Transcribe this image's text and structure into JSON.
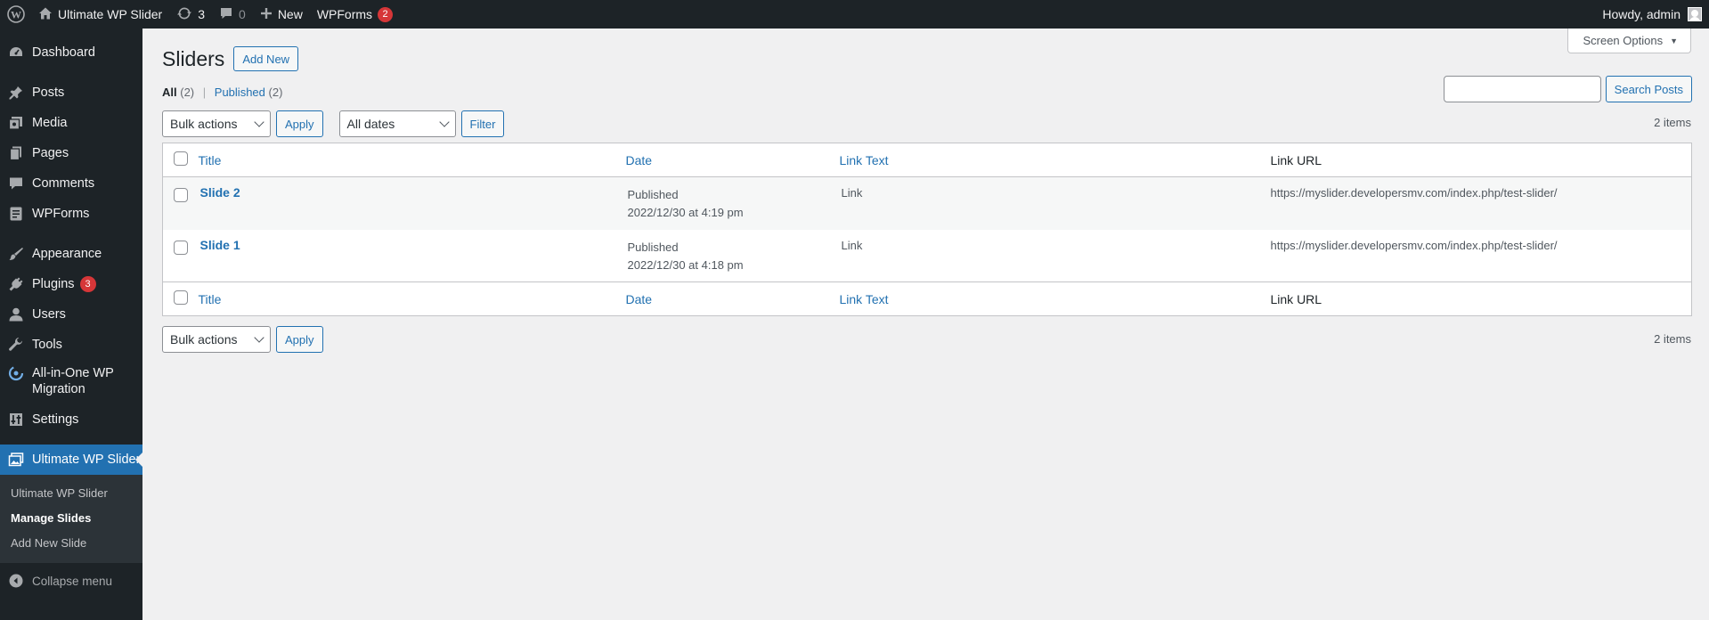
{
  "admin_bar": {
    "site_name": "Ultimate WP Slider",
    "updates_count": "3",
    "comments_count": "0",
    "new_label": "New",
    "wpforms_label": "WPForms",
    "wpforms_count": "2",
    "greeting": "Howdy, admin"
  },
  "sidebar": {
    "items": [
      {
        "label": "Dashboard",
        "icon": "dashboard-icon"
      },
      {
        "label": "Posts",
        "icon": "pin-icon"
      },
      {
        "label": "Media",
        "icon": "media-icon"
      },
      {
        "label": "Pages",
        "icon": "pages-icon"
      },
      {
        "label": "Comments",
        "icon": "comment-icon"
      },
      {
        "label": "WPForms",
        "icon": "forms-icon"
      },
      {
        "label": "Appearance",
        "icon": "brush-icon"
      },
      {
        "label": "Plugins",
        "icon": "plug-icon",
        "badge": "3"
      },
      {
        "label": "Users",
        "icon": "user-icon"
      },
      {
        "label": "Tools",
        "icon": "wrench-icon"
      },
      {
        "label": "All-in-One WP Migration",
        "line1": "All-in-One WP",
        "line2": "Migration",
        "icon": "migration-icon"
      },
      {
        "label": "Settings",
        "icon": "settings-icon"
      },
      {
        "label": "Ultimate WP Slider",
        "icon": "slider-icon"
      }
    ],
    "submenu": [
      "Ultimate WP Slider",
      "Manage Slides",
      "Add New Slide"
    ],
    "collapse_label": "Collapse menu"
  },
  "screen_options_label": "Screen Options",
  "page": {
    "title": "Sliders",
    "add_new_label": "Add New"
  },
  "views": {
    "all_label": "All",
    "all_count": "(2)",
    "separator": "|",
    "published_label": "Published",
    "published_count": "(2)"
  },
  "search": {
    "value": "",
    "button_label": "Search Posts"
  },
  "tablenav_top": {
    "bulk_actions": "Bulk actions",
    "apply_label": "Apply",
    "date_filter": "All dates",
    "filter_label": "Filter",
    "items_count": "2 items"
  },
  "table": {
    "columns": [
      "Title",
      "Date",
      "Link Text",
      "Link URL"
    ],
    "rows": [
      {
        "title": "Slide 2",
        "status": "Published",
        "date": "2022/12/30 at 4:19 pm",
        "link_text": "Link",
        "link_url": "https://myslider.developersmv.com/index.php/test-slider/"
      },
      {
        "title": "Slide 1",
        "status": "Published",
        "date": "2022/12/30 at 4:18 pm",
        "link_text": "Link",
        "link_url": "https://myslider.developersmv.com/index.php/test-slider/"
      }
    ]
  },
  "tablenav_bottom": {
    "bulk_actions": "Bulk actions",
    "apply_label": "Apply",
    "items_count": "2 items"
  },
  "colors": {
    "admin_bar_bg": "#1d2327",
    "menu_bg": "#1d2327",
    "accent": "#2271b1",
    "badge": "#d63638",
    "page_bg": "#f0f0f1"
  }
}
